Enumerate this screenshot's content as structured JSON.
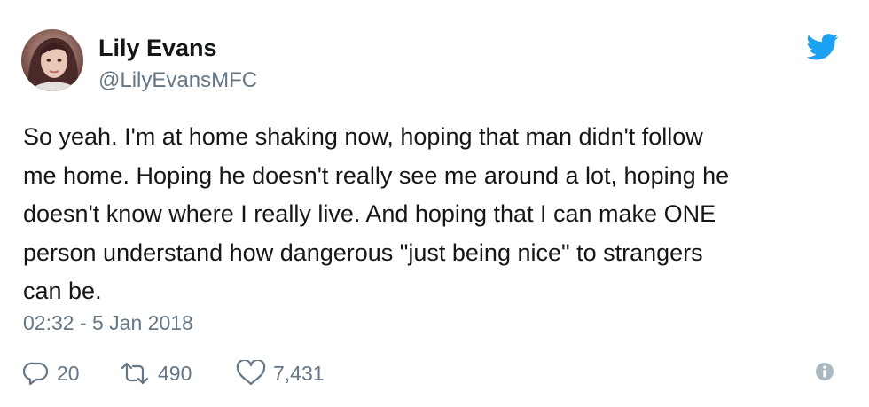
{
  "tweet": {
    "author": {
      "display_name": "Lily Evans",
      "handle": "@LilyEvansMFC",
      "avatar_icon": "profile-photo"
    },
    "brand_icon": "twitter-bird-icon",
    "text_lines": [
      "So yeah. I'm at home shaking now, hoping that man didn't follow",
      "me home. Hoping he doesn't really see me around a lot, hoping he",
      "doesn't know where I really live. And hoping that I can make ONE",
      "person understand how dangerous \"just being nice\" to strangers",
      "can be."
    ],
    "timestamp": "02:32 - 5 Jan 2018",
    "actions": {
      "replies": "20",
      "retweets": "490",
      "likes": "7,431"
    }
  },
  "colors": {
    "text": "#14171a",
    "secondary": "#657786",
    "twitter_blue": "#1da1f2",
    "info_icon": "#aab8c2"
  }
}
